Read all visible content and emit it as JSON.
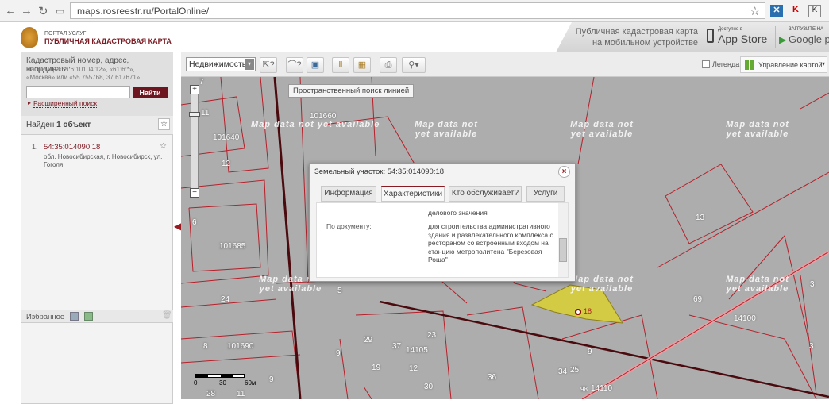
{
  "browser": {
    "url": "maps.rosreestr.ru/PortalOnline/"
  },
  "header": {
    "portal": "ПОРТАЛ УСЛУГ",
    "title": "ПУБЛИЧНАЯ КАДАСТРОВАЯ КАРТА",
    "mobile_line1": "Публичная кадастровая карта",
    "mobile_line2": "на мобильном устройстве",
    "appstore_small": "Доступно в",
    "appstore": "App Store",
    "google_small": "ЗАГРУЗИТЕ НА",
    "google": "Google play"
  },
  "search": {
    "label": "Кадастровый номер, адрес, координата:",
    "example1": "Например «61:6:10104:12», «61:6:*»,",
    "example2": "«Москва» или «55.755768, 37.617671»",
    "value": "",
    "button": "Найти",
    "advanced": "Расширенный поиск"
  },
  "results": {
    "found_prefix": "Найден",
    "found_count": "1 объект",
    "items": [
      {
        "num": "1.",
        "id": "54:35:014090:18",
        "address": "обл. Новосибирская, г. Новосибирск, ул. Гоголя"
      }
    ]
  },
  "favorites": {
    "label": "Избранное"
  },
  "toolbar": {
    "layer_select": "Недвижимость",
    "tooltip": "Пространственный поиск линией",
    "legend": "Легенда",
    "map_control": "Управление картой"
  },
  "popup": {
    "title": "Земельный участок: 54:35:014090:18",
    "tabs": [
      "Информация",
      "Характеристики",
      "Кто обслуживает?",
      "Услуги"
    ],
    "active_tab": "Характеристики",
    "row0_value": "делового значения",
    "row1_label": "По документу:",
    "row1_value": "для строительства административного здания и развлекательного комплекса с рестораном со встроенным входом на станцию метрополитена \"Березовая Роща\""
  },
  "map": {
    "no_data": "Map data not yet available",
    "scale": [
      "0",
      "30",
      "60м"
    ],
    "labels": [
      "7",
      "11",
      "101660",
      "101640",
      "12",
      "6",
      "101685",
      "24",
      "5",
      "8",
      "101690",
      "9",
      "29",
      "37",
      "23",
      "14105",
      "19",
      "12",
      "36",
      "30",
      "9",
      "34",
      "25",
      "98",
      "14110",
      "13",
      "69",
      "14100",
      "3",
      "18",
      "28",
      "11",
      "9",
      "8",
      "3"
    ]
  },
  "colors": {
    "accent": "#7a1a22",
    "parcel_line": "#b5202a",
    "selected_parcel": "#d9cf3a",
    "map_bg": "#adadad"
  }
}
